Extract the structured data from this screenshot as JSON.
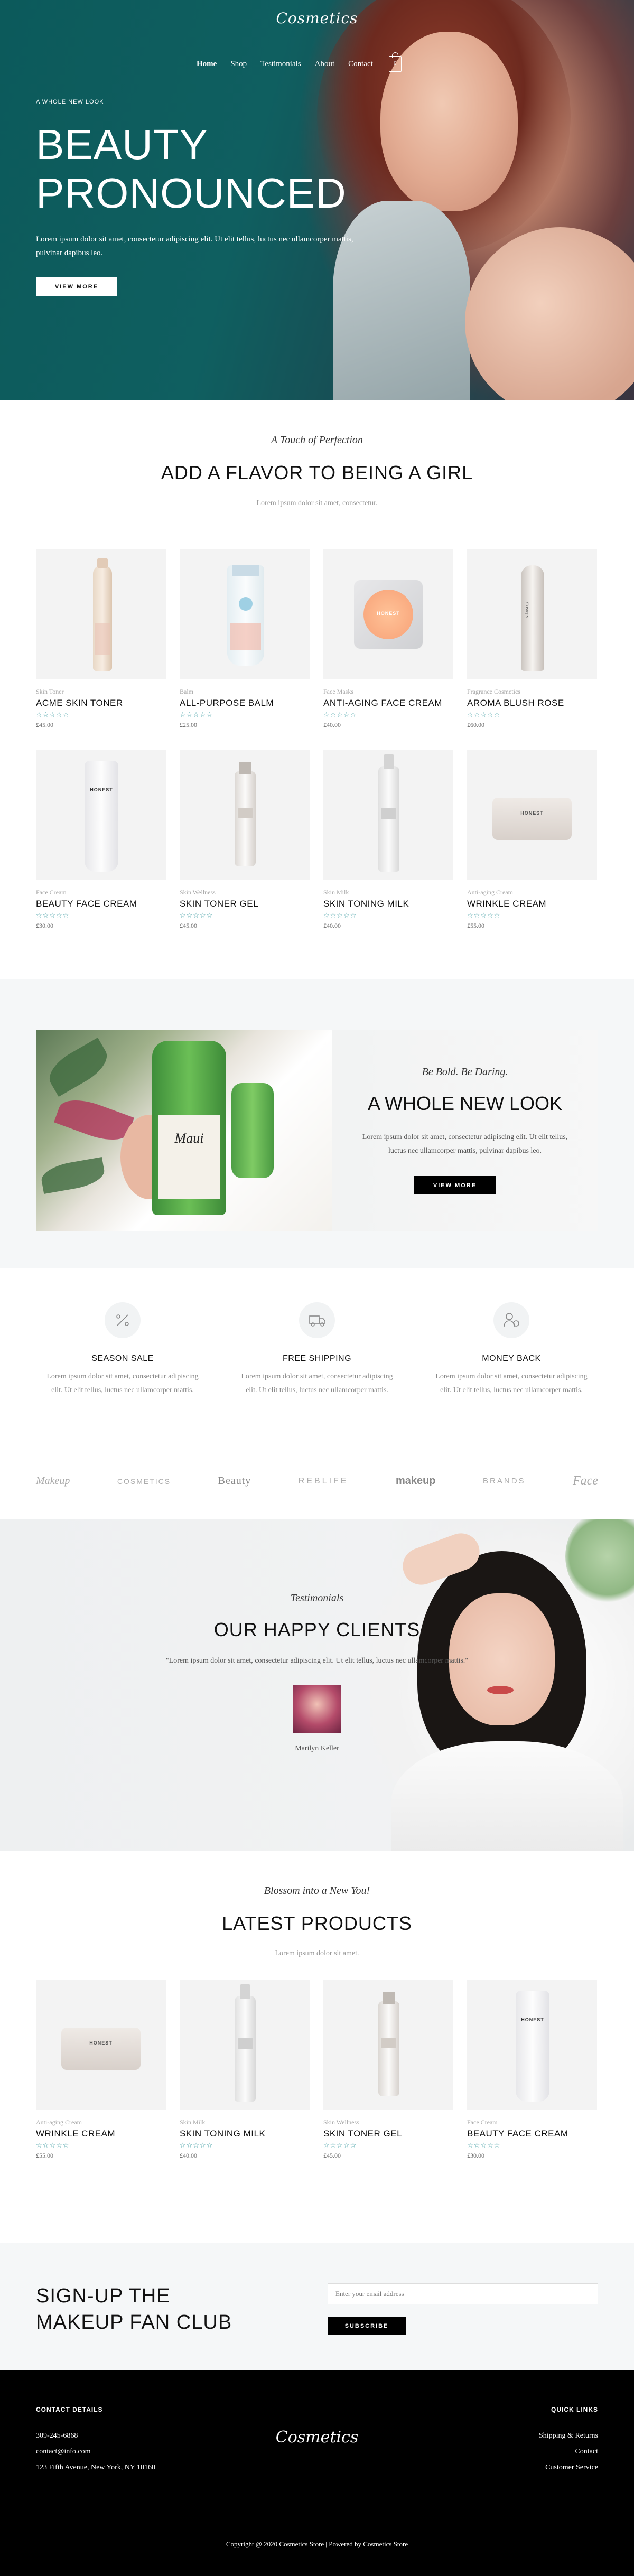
{
  "brand": {
    "logo": "Cosmetics"
  },
  "nav": {
    "items": [
      "Home",
      "Shop",
      "Testimonials",
      "About",
      "Contact"
    ],
    "cart_count": "0"
  },
  "hero": {
    "eyebrow": "A WHOLE NEW LOOK",
    "title_line1": "BEAUTY",
    "title_line2": "PRONOUNCED",
    "text": "Lorem ipsum dolor sit amet, consectetur adipiscing elit. Ut elit tellus, luctus nec ullamcorper mattis, pulvinar dapibus leo.",
    "button": "VIEW MORE"
  },
  "featured": {
    "script": "A Touch of Perfection",
    "title": "ADD A FLAVOR TO BEING A GIRL",
    "subtitle": "Lorem ipsum dolor sit amet, consectetur.",
    "products": [
      {
        "category": "Skin Toner",
        "name": "ACME SKIN TONER",
        "stars": "☆☆☆☆☆",
        "price": "£45.00"
      },
      {
        "category": "Balm",
        "name": "ALL-PURPOSE BALM",
        "stars": "☆☆☆☆☆",
        "price": "£25.00"
      },
      {
        "category": "Face Masks",
        "name": "ANTI-AGING FACE CREAM",
        "stars": "☆☆☆☆☆",
        "price": "£40.00"
      },
      {
        "category": "Fragrance Cosmetics",
        "name": "AROMA BLUSH ROSE",
        "stars": "☆☆☆☆☆",
        "price": "£60.00"
      },
      {
        "category": "Face Cream",
        "name": "BEAUTY FACE CREAM",
        "stars": "☆☆☆☆☆",
        "price": "£30.00"
      },
      {
        "category": "Skin Wellness",
        "name": "SKIN TONER GEL",
        "stars": "☆☆☆☆☆",
        "price": "£45.00"
      },
      {
        "category": "Skin Milk",
        "name": "SKIN TONING MILK",
        "stars": "☆☆☆☆☆",
        "price": "£40.00"
      },
      {
        "category": "Anti-aging Cream",
        "name": "WRINKLE CREAM",
        "stars": "☆☆☆☆☆",
        "price": "£55.00"
      }
    ],
    "labels": {
      "honest": "HONEST",
      "glossier": "Cosrepy"
    }
  },
  "promo": {
    "script": "Be Bold. Be Daring.",
    "title": "A WHOLE NEW LOOK",
    "text": "Lorem ipsum dolor sit amet, consectetur adipiscing elit. Ut elit tellus, luctus nec ullamcorper mattis, pulvinar dapibus leo.",
    "button": "VIEW MORE",
    "bottle_label": "Maui"
  },
  "features": [
    {
      "icon": "percent-tag-icon",
      "title": "SEASON SALE",
      "text": "Lorem ipsum dolor sit amet, consectetur adipiscing elit. Ut elit tellus, luctus nec ullamcorper mattis."
    },
    {
      "icon": "truck-icon",
      "title": "FREE SHIPPING",
      "text": "Lorem ipsum dolor sit amet, consectetur adipiscing elit. Ut elit tellus, luctus nec ullamcorper mattis."
    },
    {
      "icon": "money-user-icon",
      "title": "MONEY BACK",
      "text": "Lorem ipsum dolor sit amet, consectetur adipiscing elit. Ut elit tellus, luctus nec ullamcorper mattis."
    }
  ],
  "brands": [
    "Makeup",
    "COSMETICS",
    "Beauty",
    "REBLIFE",
    "makeup",
    "BRANDS",
    "Face"
  ],
  "testimonials": {
    "script": "Testimonials",
    "title": "OUR HAPPY CLIENTS",
    "quote": "\"Lorem ipsum dolor sit amet, consectetur adipiscing elit. Ut elit tellus, luctus nec ullamcorper mattis.\"",
    "author": "Marilyn Keller"
  },
  "latest": {
    "script": "Blossom into a New You!",
    "title": "LATEST PRODUCTS",
    "subtitle": "Lorem ipsum dolor sit amet.",
    "products": [
      {
        "category": "Anti-aging Cream",
        "name": "WRINKLE CREAM",
        "stars": "☆☆☆☆☆",
        "price": "£55.00"
      },
      {
        "category": "Skin Milk",
        "name": "SKIN TONING MILK",
        "stars": "☆☆☆☆☆",
        "price": "£40.00"
      },
      {
        "category": "Skin Wellness",
        "name": "SKIN TONER GEL",
        "stars": "☆☆☆☆☆",
        "price": "£45.00"
      },
      {
        "category": "Face Cream",
        "name": "BEAUTY FACE CREAM",
        "stars": "☆☆☆☆☆",
        "price": "£30.00"
      }
    ]
  },
  "newsletter": {
    "title_line1": "SIGN-UP THE",
    "title_line2": "MAKEUP FAN CLUB",
    "placeholder": "Enter your email address",
    "button": "SUBSCRIBE"
  },
  "footer": {
    "contact_heading": "CONTACT DETAILS",
    "phone": "309-245-6868",
    "email": "contact@info.com",
    "address": "123 Fifth Avenue, New York, NY 10160",
    "links_heading": "QUICK LINKS",
    "links": [
      "Shipping & Returns",
      "Contact",
      "Customer Service"
    ],
    "copyright": "Copyright @ 2020 Cosmetics Store | Powered by Cosmetics Store"
  },
  "colors": {
    "hero_teal": "#0f5f60",
    "star": "#4aa3a8",
    "footer_bg": "#000000",
    "section_bg": "#f5f7f8"
  }
}
